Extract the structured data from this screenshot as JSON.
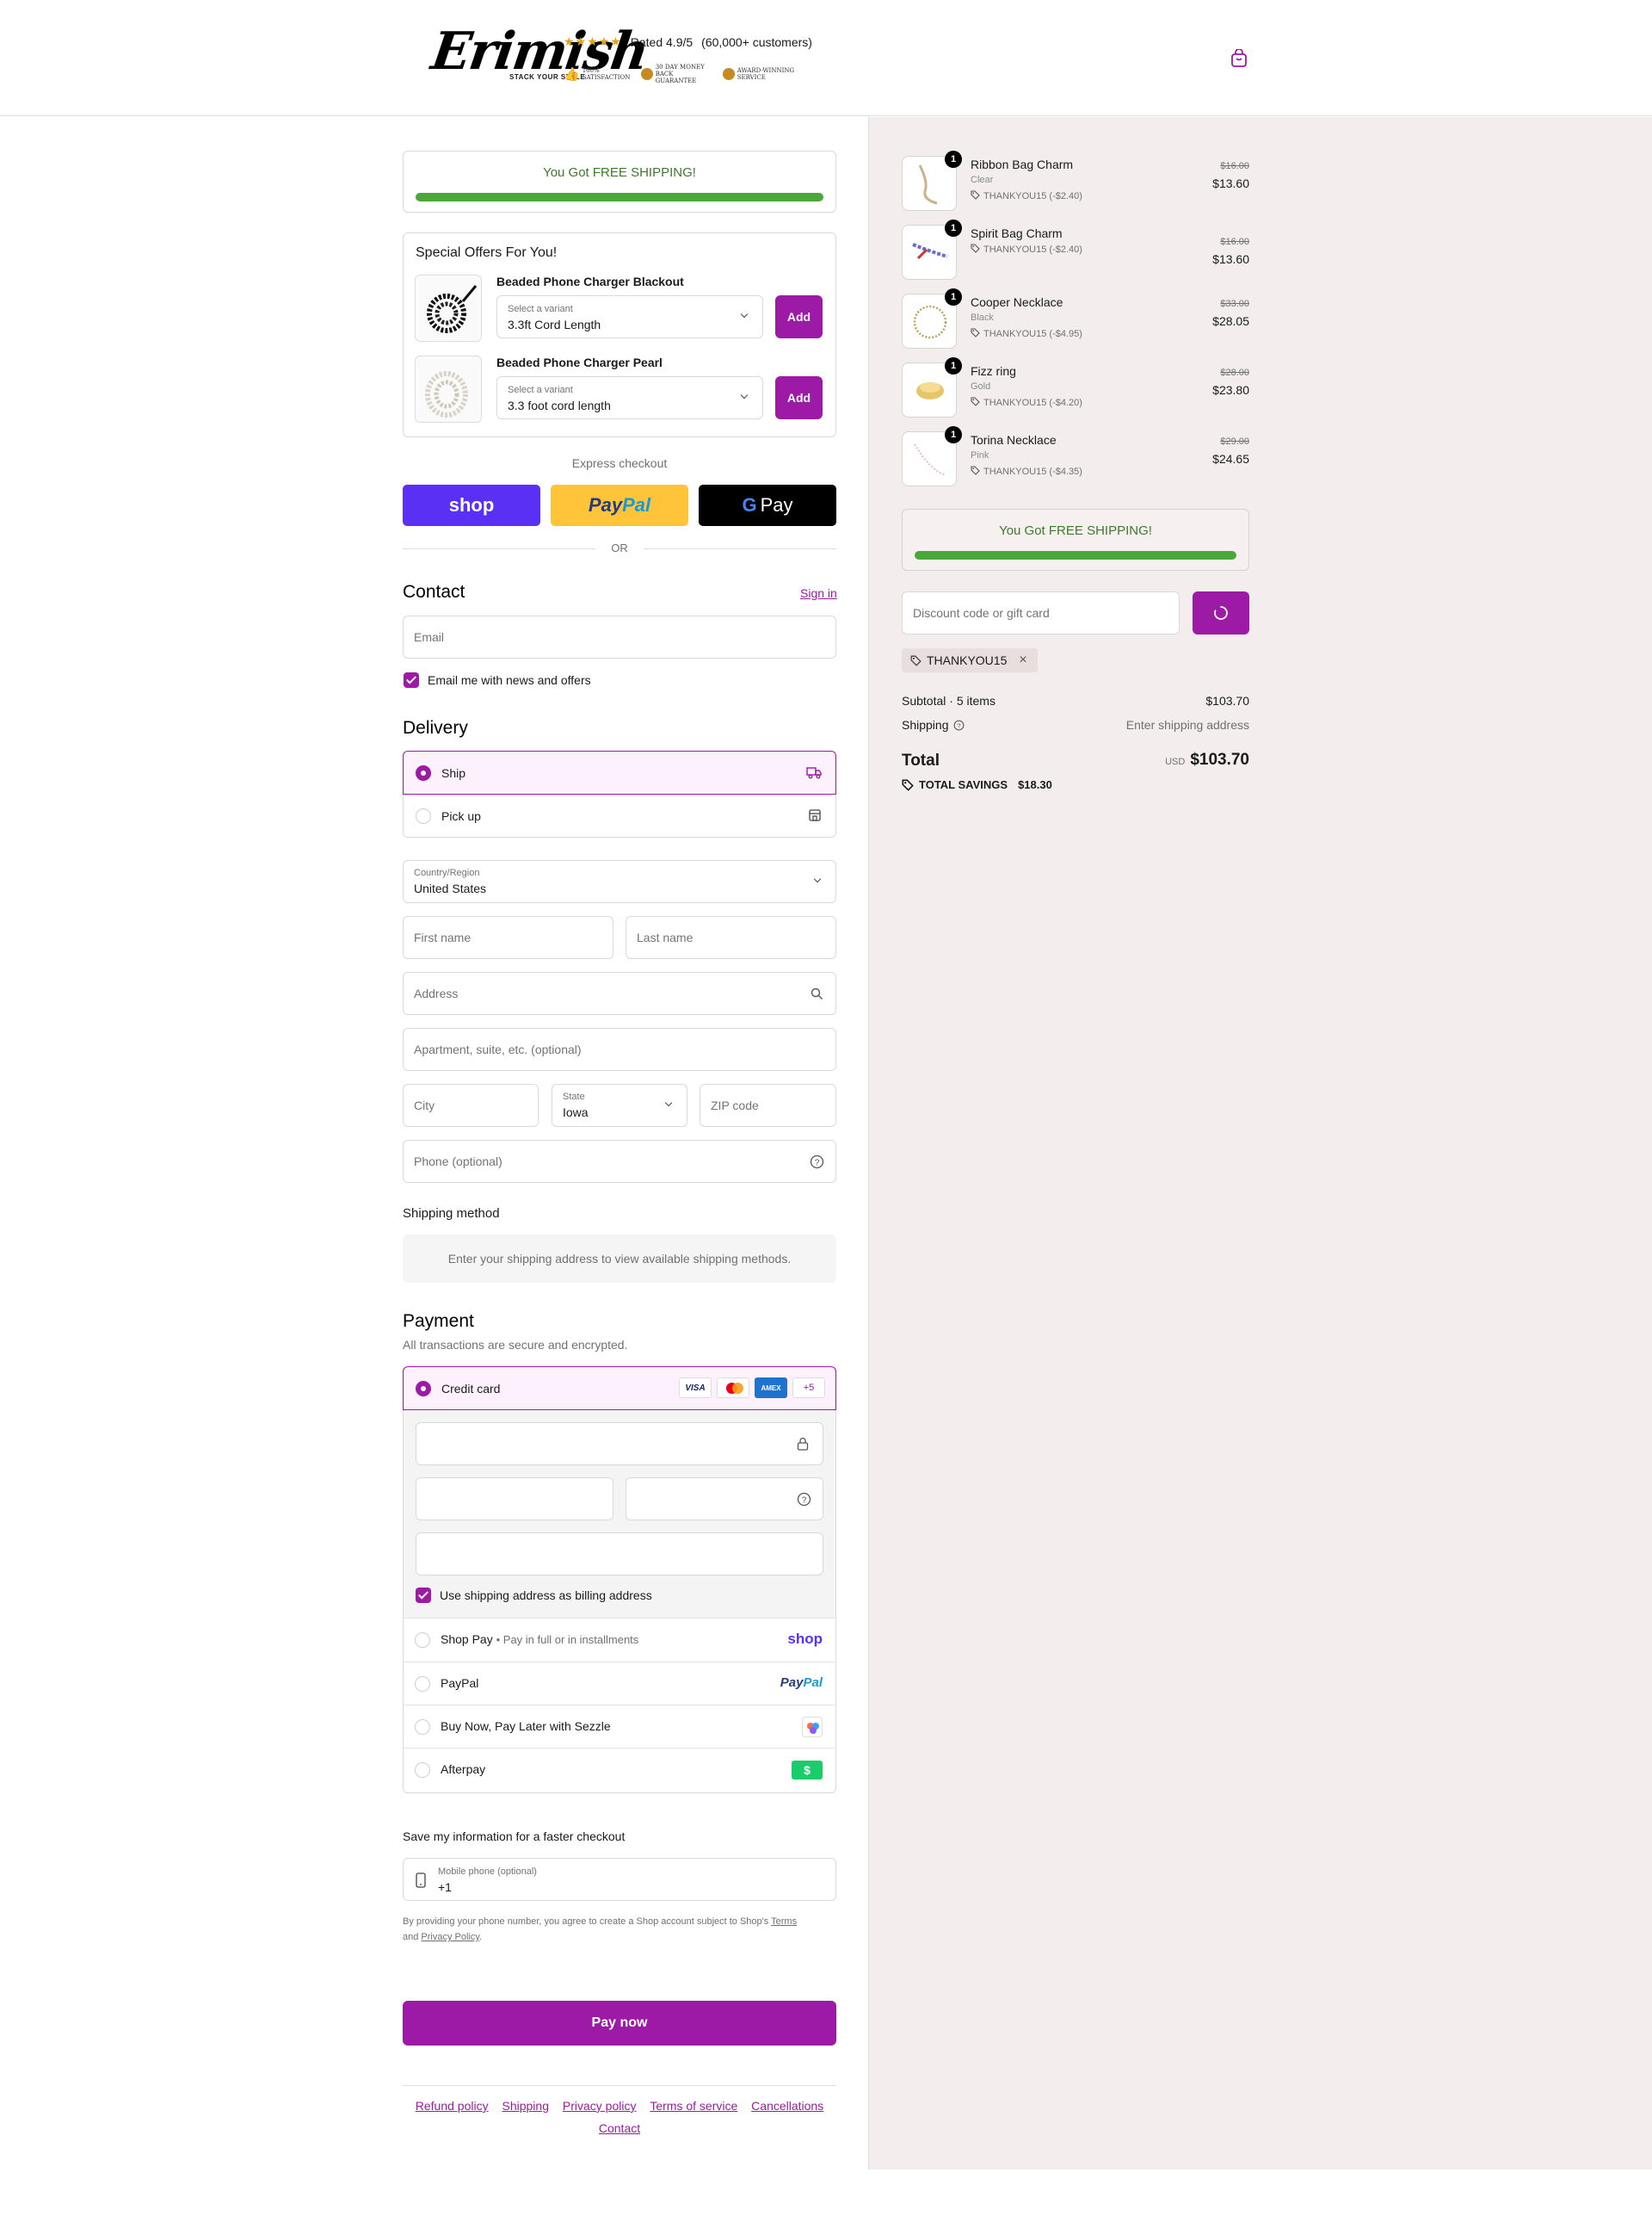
{
  "header": {
    "logo": "Erimish",
    "tagline": "STACK YOUR STYLE",
    "stars": "★★★★★",
    "rating": "Rated 4.9/5",
    "customers": "(60,000+ customers)",
    "badges": [
      "100% SATISFACTION",
      "30 DAY MONEY BACK GUARANTEE",
      "AWARD-WINNING SERVICE"
    ]
  },
  "shipping_banner": {
    "text_prefix": "You Got ",
    "text_highlight": "FREE SHIPPING!",
    "progress": 1.0
  },
  "offers": {
    "title": "Special Offers For You!",
    "items": [
      {
        "name": "Beaded Phone Charger Blackout",
        "variant_label": "Select a variant",
        "variant": "3.3ft Cord Length",
        "button": "Add"
      },
      {
        "name": "Beaded Phone Charger Pearl",
        "variant_label": "Select a variant",
        "variant": "3.3 foot cord length",
        "button": "Add"
      }
    ]
  },
  "express": {
    "label": "Express checkout",
    "shop": "shop",
    "paypal_a": "Pay",
    "paypal_b": "Pal",
    "gpay": "Pay",
    "or": "OR"
  },
  "contact": {
    "title": "Contact",
    "sign_in": "Sign in",
    "email_placeholder": "Email",
    "newsletter": "Email me with news and offers"
  },
  "delivery": {
    "title": "Delivery",
    "ship": "Ship",
    "pickup": "Pick up",
    "country_label": "Country/Region",
    "country": "United States",
    "first_name": "First name",
    "last_name": "Last name",
    "address": "Address",
    "apartment": "Apartment, suite, etc. (optional)",
    "city": "City",
    "state_label": "State",
    "state": "Iowa",
    "zip": "ZIP code",
    "phone": "Phone (optional)"
  },
  "shipping_method": {
    "title": "Shipping method",
    "message": "Enter your shipping address to view available shipping methods."
  },
  "payment": {
    "title": "Payment",
    "subtitle": "All transactions are secure and encrypted.",
    "credit_card": "Credit card",
    "card_brands": [
      "VISA",
      "AMEX"
    ],
    "more_brands": "+5",
    "billing_same": "Use shipping address as billing address",
    "shop_pay": "Shop Pay",
    "shop_pay_sub": "Pay in full or in installments",
    "shop_pay_logo": "shop",
    "paypal": "PayPal",
    "paypal_logo_a": "Pay",
    "paypal_logo_b": "Pal",
    "sezzle": "Buy Now, Pay Later with Sezzle",
    "afterpay": "Afterpay",
    "afterpay_logo": "$"
  },
  "save_info": {
    "title": "Save my information for a faster checkout",
    "mobile_label": "Mobile phone (optional)",
    "mobile_value": "+1",
    "disclaimer_a": "By providing your phone number, you agree to create a Shop account subject to Shop's ",
    "terms": "Terms",
    "disclaimer_b": "and ",
    "privacy": "Privacy Policy",
    "disclaimer_c": "."
  },
  "pay_now": "Pay now",
  "footer": [
    "Refund policy",
    "Shipping",
    "Privacy policy",
    "Terms of service",
    "Cancellations",
    "Contact"
  ],
  "summary": {
    "items": [
      {
        "qty": "1",
        "name": "Ribbon Bag Charm",
        "variant": "Clear",
        "discount": "THANKYOU15 (-$2.40)",
        "original": "$16.00",
        "price": "$13.60"
      },
      {
        "qty": "1",
        "name": "Spirit Bag Charm",
        "variant": "",
        "discount": "THANKYOU15 (-$2.40)",
        "original": "$16.00",
        "price": "$13.60"
      },
      {
        "qty": "1",
        "name": "Cooper Necklace",
        "variant": "Black",
        "discount": "THANKYOU15 (-$4.95)",
        "original": "$33.00",
        "price": "$28.05"
      },
      {
        "qty": "1",
        "name": "Fizz ring",
        "variant": "Gold",
        "discount": "THANKYOU15 (-$4.20)",
        "original": "$28.00",
        "price": "$23.80"
      },
      {
        "qty": "1",
        "name": "Torina Necklace",
        "variant": "Pink",
        "discount": "THANKYOU15 (-$4.35)",
        "original": "$29.00",
        "price": "$24.65"
      }
    ],
    "discount_placeholder": "Discount code or gift card",
    "applied_code": "THANKYOU15",
    "subtotal_label": "Subtotal · 5 items",
    "subtotal": "$103.70",
    "shipping_label": "Shipping",
    "shipping_value": "Enter shipping address",
    "total_label": "Total",
    "currency": "USD",
    "total": "$103.70",
    "savings_label": "TOTAL SAVINGS",
    "savings": "$18.30"
  },
  "colors": {
    "accent": "#9c1aa6",
    "progress": "#4aa83b",
    "shop": "#5a31f4",
    "paypal": "#ffc439"
  }
}
